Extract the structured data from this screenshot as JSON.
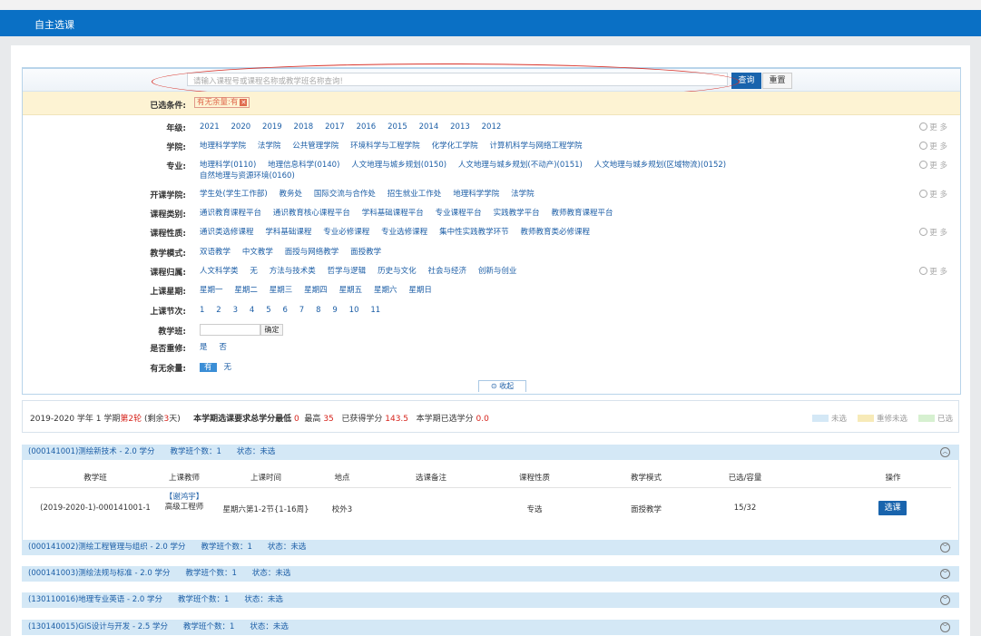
{
  "title": "自主选课",
  "search": {
    "placeholder": "请输入课程号或课程名称或教学班名称查询!",
    "query_label": "查询",
    "reset_label": "重置"
  },
  "conditions": {
    "label": "已选条件:",
    "tag": "有无余量:有"
  },
  "filters": [
    {
      "label": "年级:",
      "options": [
        "2021",
        "2020",
        "2019",
        "2018",
        "2017",
        "2016",
        "2015",
        "2014",
        "2013",
        "2012"
      ],
      "more": "更 多"
    },
    {
      "label": "学院:",
      "options": [
        "地理科学学院",
        "法学院",
        "公共管理学院",
        "环境科学与工程学院",
        "化学化工学院",
        "计算机科学与网络工程学院"
      ],
      "more": "更 多"
    },
    {
      "label": "专业:",
      "options": [
        "地理科学(0110)",
        "地理信息科学(0140)",
        "人文地理与城乡规划(0150)",
        "人文地理与城乡规划(不动产)(0151)",
        "人文地理与城乡规划(区域物流)(0152)",
        "自然地理与资源环境(0160)"
      ],
      "more": "更 多"
    },
    {
      "label": "开课学院:",
      "options": [
        "学生处(学生工作部)",
        "教务处",
        "国际交流与合作处",
        "招生就业工作处",
        "地理科学学院",
        "法学院"
      ],
      "more": "更 多"
    },
    {
      "label": "课程类别:",
      "options": [
        "通识教育课程平台",
        "通识教育核心课程平台",
        "学科基础课程平台",
        "专业课程平台",
        "实践教学平台",
        "教师教育课程平台"
      ]
    },
    {
      "label": "课程性质:",
      "options": [
        "通识类选修课程",
        "学科基础课程",
        "专业必修课程",
        "专业选修课程",
        "集中性实践教学环节",
        "教师教育类必修课程"
      ],
      "more": "更 多"
    },
    {
      "label": "教学模式:",
      "options": [
        "双语教学",
        "中文教学",
        "面授与网络教学",
        "面授教学"
      ]
    },
    {
      "label": "课程归属:",
      "options": [
        "人文科学类",
        "无",
        "方法与技术类",
        "哲学与逻辑",
        "历史与文化",
        "社会与经济",
        "创新与创业"
      ],
      "more": "更 多"
    },
    {
      "label": "上课星期:",
      "options": [
        "星期一",
        "星期二",
        "星期三",
        "星期四",
        "星期五",
        "星期六",
        "星期日"
      ]
    },
    {
      "label": "上课节次:",
      "options": [
        "1",
        "2",
        "3",
        "4",
        "5",
        "6",
        "7",
        "8",
        "9",
        "10",
        "11"
      ]
    },
    {
      "label": "教学班:",
      "confirm": "确定"
    },
    {
      "label": "是否重修:",
      "options": [
        "是",
        "否"
      ]
    },
    {
      "label": "有无余量:",
      "selected": "有",
      "options": [
        "无"
      ]
    }
  ],
  "collapse_label": "收起",
  "info": {
    "term": "2019-2020 学年 1 学期",
    "round": "第2轮",
    "remain_pre": "(剩余",
    "remain_days": "3",
    "remain_post": "天)",
    "req_pre": "本学期选课要求总学分最低",
    "min_credit": "0",
    "max_label": "最高",
    "max_credit": "35",
    "got_label": "已获得学分",
    "got_credit": "143.5",
    "sel_label": "本学期已选学分",
    "sel_credit": "0.0"
  },
  "legend": [
    {
      "label": "未选",
      "color": "#d4e8f6"
    },
    {
      "label": "重修未选",
      "color": "#f7eab8"
    },
    {
      "label": "已选",
      "color": "#d6f0d0"
    }
  ],
  "courses": [
    {
      "text": "(000141001)测绘新技术 - 2.0 学分　　教学班个数：1　　状态：未选"
    },
    {
      "text": "(000141002)测绘工程管理与组织 - 2.0 学分　　教学班个数：1　　状态：未选"
    },
    {
      "text": "(000141003)测绘法规与标准 - 2.0 学分　　教学班个数：1　　状态：未选"
    },
    {
      "text": "(130110016)地理专业英语 - 2.0 学分　　教学班个数：1　　状态：未选"
    },
    {
      "text": "(130140015)GIS设计与开发 - 2.5 学分　　教学班个数：1　　状态：未选"
    }
  ],
  "table": {
    "headers": [
      "教学班",
      "上课教师",
      "上课时间",
      "地点",
      "选课备注",
      "课程性质",
      "教学模式",
      "已选/容量",
      "操作"
    ],
    "row": {
      "cls": "(2019-2020-1)-000141001-1",
      "teacher_name": "【谢鸿宇】",
      "teacher_title": "高级工程师",
      "time": "星期六第1-2节{1-16周}",
      "place": "校外3",
      "remark": "",
      "nature": "专选",
      "mode": "面授教学",
      "capacity": "15/32",
      "action": "选课"
    }
  }
}
